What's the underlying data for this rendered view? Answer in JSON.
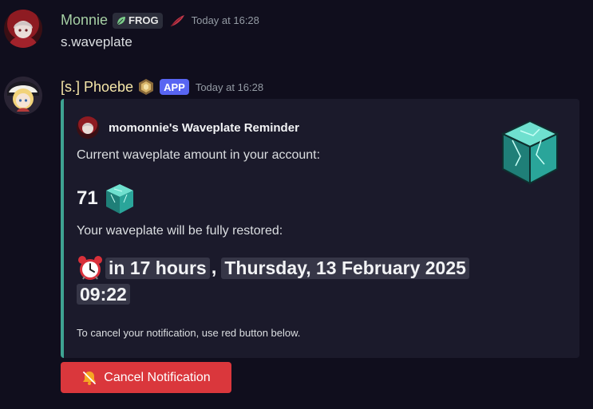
{
  "messages": [
    {
      "username": "Monnie",
      "username_color": "#a6d0a4",
      "tag": "FROG",
      "timestamp": "Today at 16:28",
      "content": "s.waveplate"
    },
    {
      "username": "[s.] Phoebe",
      "username_color": "#f5e6a8",
      "tag": "APP",
      "timestamp": "Today at 16:28"
    }
  ],
  "embed": {
    "accent_color": "#3ea392",
    "author": "momonnie's Waveplate Reminder",
    "line1": "Current waveplate amount in your account:",
    "amount": "71",
    "line2": "Your waveplate will be fully restored:",
    "relative_time": "in 17 hours",
    "separator": ",",
    "date": "Thursday, 13 February 2025",
    "time": "09:22",
    "footer": "To cancel your notification, use red button below."
  },
  "buttons": {
    "cancel_label": "Cancel Notification"
  },
  "icons": {
    "tag_leaf": "leaf-icon",
    "feather": "feather-icon",
    "bot_emblem": "hexagon-emblem-icon",
    "waveplate": "waveplate-cube-icon",
    "alarm": "alarm-clock-icon",
    "bell": "bell-slash-icon"
  }
}
